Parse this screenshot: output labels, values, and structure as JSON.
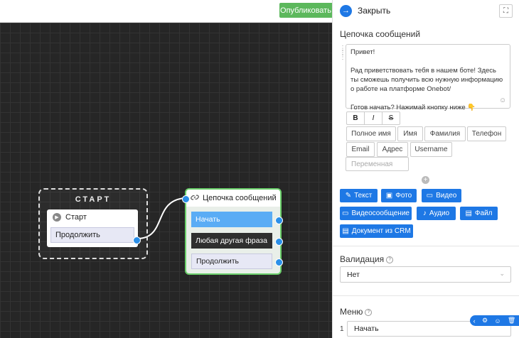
{
  "topbar": {
    "publish_label": "Опубликовать"
  },
  "canvas": {
    "start_node": {
      "title": "СТАРТ",
      "start_label": "Старт",
      "continue_label": "Продолжить"
    },
    "chain_node": {
      "title": "Цепочка сообщений",
      "buttons": [
        "Начать",
        "Любая другая фраза",
        "Продолжить"
      ]
    }
  },
  "panel": {
    "close_label": "Закрыть",
    "section_title": "Цепочка сообщений",
    "message_text": "Привет!\n\nРад приветствовать тебя в нашем боте! Здесь ты сможешь получить всю нужную информацию о работе на платформе Onebot/\n\nГотов начать? Нажимай кнопку ниже 👇",
    "format_buttons": [
      "B",
      "I",
      "S"
    ],
    "variable_chips": [
      "Полное имя",
      "Имя",
      "Фамилия",
      "Телефон",
      "Email",
      "Адрес",
      "Username"
    ],
    "variable_placeholder": "Переменная",
    "add_buttons": [
      "Текст",
      "Фото",
      "Видео",
      "Видеосообщение",
      "Аудио",
      "Файл",
      "Документ из CRM"
    ],
    "validation_label": "Валидация",
    "validation_value": "Нет",
    "menu_label": "Меню",
    "menu_items": [
      {
        "num": "1",
        "value": "Начать"
      }
    ]
  },
  "icons": [
    "arrow-right-icon",
    "expand-icon",
    "emoji-icon",
    "link-icon",
    "play-icon",
    "plus-icon",
    "pencil-icon",
    "image-icon",
    "video-icon",
    "mic-icon",
    "file-icon",
    "chevron-down-icon",
    "gear-icon",
    "trash-icon"
  ],
  "colors": {
    "accent": "#1e78e5",
    "publish": "#5cb85c",
    "node_border": "#6bd06b",
    "highlight": "#5aacf5",
    "dark_button": "#2f2f2f"
  }
}
